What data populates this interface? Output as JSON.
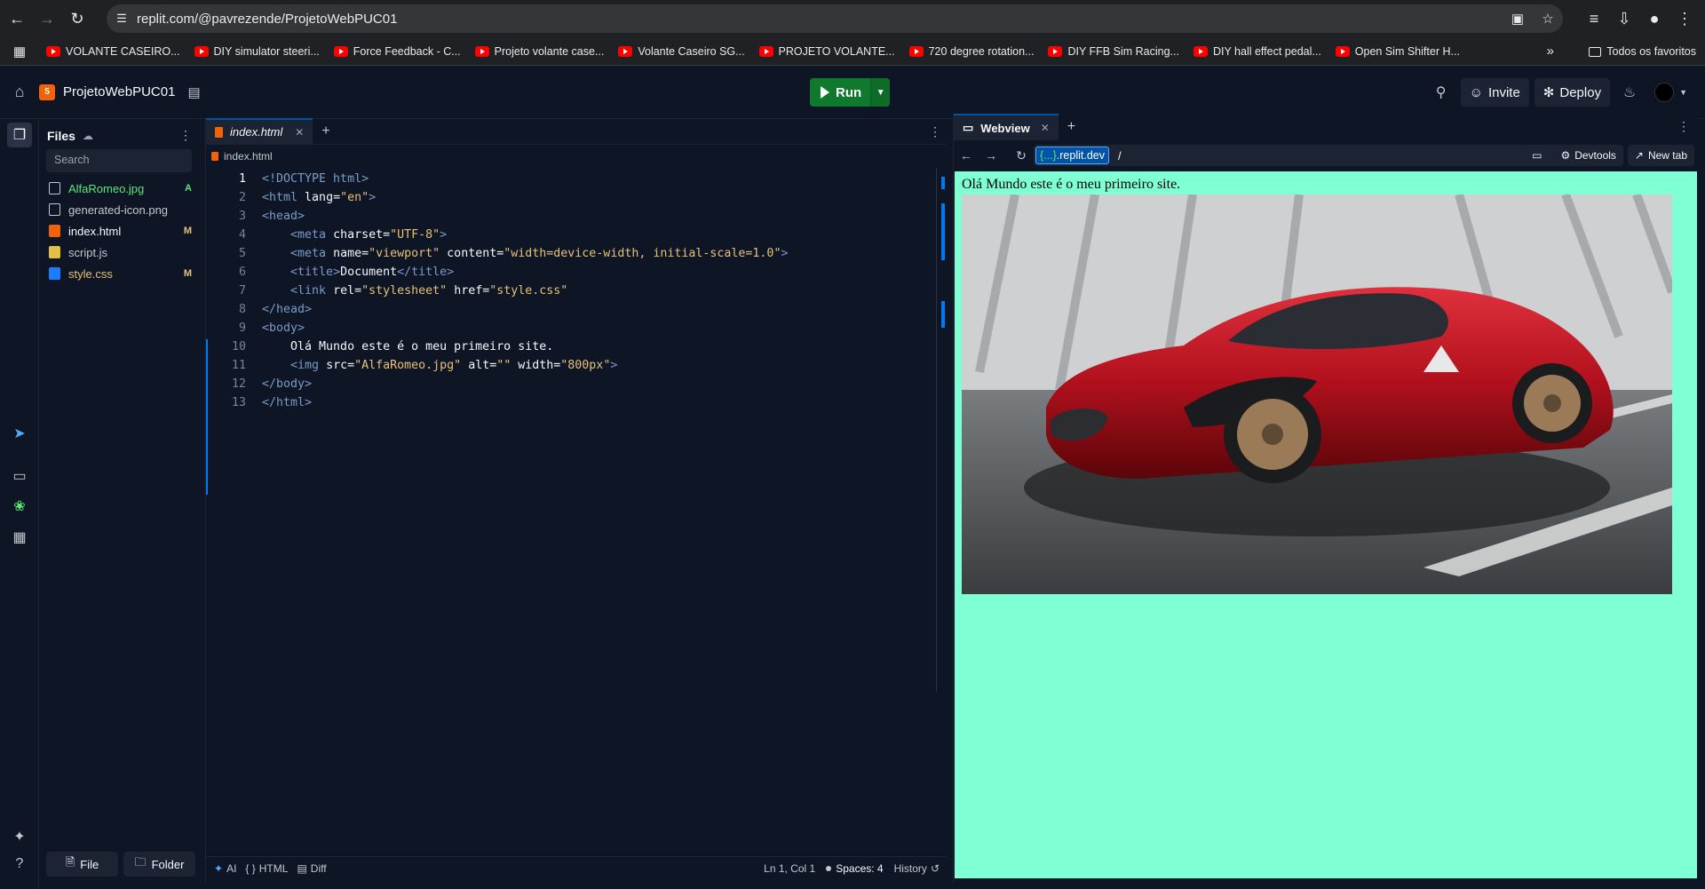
{
  "browser": {
    "url": "replit.com/@pavrezende/ProjetoWebPUC01",
    "bookmarks": [
      "VOLANTE CASEIRO...",
      "DIY simulator steeri...",
      "Force Feedback - C...",
      "Projeto volante case...",
      "Volante Caseiro SG...",
      "PROJETO VOLANTE...",
      "720 degree rotation...",
      "DIY FFB Sim Racing...",
      "DIY hall effect pedal...",
      "Open Sim Shifter H..."
    ],
    "all_bookmarks": "Todos os favoritos"
  },
  "header": {
    "project_name": "ProjetoWebPUC01",
    "run_label": "Run",
    "invite_label": "Invite",
    "deploy_label": "Deploy"
  },
  "files": {
    "title": "Files",
    "search_placeholder": "Search",
    "items": [
      {
        "name": "AlfaRomeo.jpg",
        "badge": "A",
        "color": "#58e878",
        "badge_color": "#58e878",
        "type": "img"
      },
      {
        "name": "generated-icon.png",
        "badge": "",
        "color": "#c2c8cc",
        "badge_color": "",
        "type": "img"
      },
      {
        "name": "index.html",
        "badge": "M",
        "color": "#f5f9fc",
        "badge_color": "#e6c178",
        "type": "html"
      },
      {
        "name": "script.js",
        "badge": "",
        "color": "#c2c8cc",
        "badge_color": "",
        "type": "js"
      },
      {
        "name": "style.css",
        "badge": "M",
        "color": "#e6c178",
        "badge_color": "#e6c178",
        "type": "css"
      }
    ],
    "new_file_label": "File",
    "new_folder_label": "Folder"
  },
  "editor": {
    "tab_label": "index.html",
    "breadcrumb": "index.html",
    "lines": [
      [
        [
          "tg",
          "<!DOCTYPE html>"
        ]
      ],
      [
        [
          "tg",
          "<html "
        ],
        [
          "at",
          "lang="
        ],
        [
          "st",
          "\"en\""
        ],
        [
          "tg",
          ">"
        ]
      ],
      [
        [
          "tg",
          "<head>"
        ]
      ],
      [
        [
          "tx",
          "    "
        ],
        [
          "tg",
          "<meta "
        ],
        [
          "at",
          "charset="
        ],
        [
          "st",
          "\"UTF-8\""
        ],
        [
          "tg",
          ">"
        ]
      ],
      [
        [
          "tx",
          "    "
        ],
        [
          "tg",
          "<meta "
        ],
        [
          "at",
          "name="
        ],
        [
          "st",
          "\"viewport\""
        ],
        [
          "at",
          " content="
        ],
        [
          "st",
          "\"width=device-width, initial-scale=1.0\""
        ],
        [
          "tg",
          ">"
        ]
      ],
      [
        [
          "tx",
          "    "
        ],
        [
          "tg",
          "<title>"
        ],
        [
          "tx",
          "Document"
        ],
        [
          "tg",
          "</title>"
        ]
      ],
      [
        [
          "tx",
          "    "
        ],
        [
          "tg",
          "<link "
        ],
        [
          "at",
          "rel="
        ],
        [
          "st",
          "\"stylesheet\""
        ],
        [
          "at",
          " href="
        ],
        [
          "st",
          "\"style.css\""
        ]
      ],
      [
        [
          "tg",
          "</head>"
        ]
      ],
      [
        [
          "tg",
          "<body>"
        ]
      ],
      [
        [
          "tx",
          "    Olá Mundo este é o meu primeiro site."
        ]
      ],
      [
        [
          "tx",
          "    "
        ],
        [
          "tg",
          "<img "
        ],
        [
          "at",
          "src="
        ],
        [
          "st",
          "\"AlfaRomeo.jpg\""
        ],
        [
          "at",
          " alt="
        ],
        [
          "st",
          "\"\""
        ],
        [
          "at",
          " width="
        ],
        [
          "st",
          "\"800px\""
        ],
        [
          "tg",
          ">"
        ]
      ],
      [
        [
          "tg",
          "</body>"
        ]
      ],
      [
        [
          "tg",
          "</html>"
        ]
      ]
    ],
    "status": {
      "ai": "AI",
      "language": "HTML",
      "diff": "Diff",
      "cursor": "Ln 1, Col 1",
      "spaces": "Spaces: 4",
      "history": "History"
    }
  },
  "webview": {
    "tab_label": "Webview",
    "host": ".replit.dev",
    "host_prefix": "{...}",
    "path": "/",
    "devtools_label": "Devtools",
    "new_tab_label": "New tab",
    "page_text": "Olá Mundo este é o meu primeiro site.",
    "page_bg": "#7fffd4"
  }
}
